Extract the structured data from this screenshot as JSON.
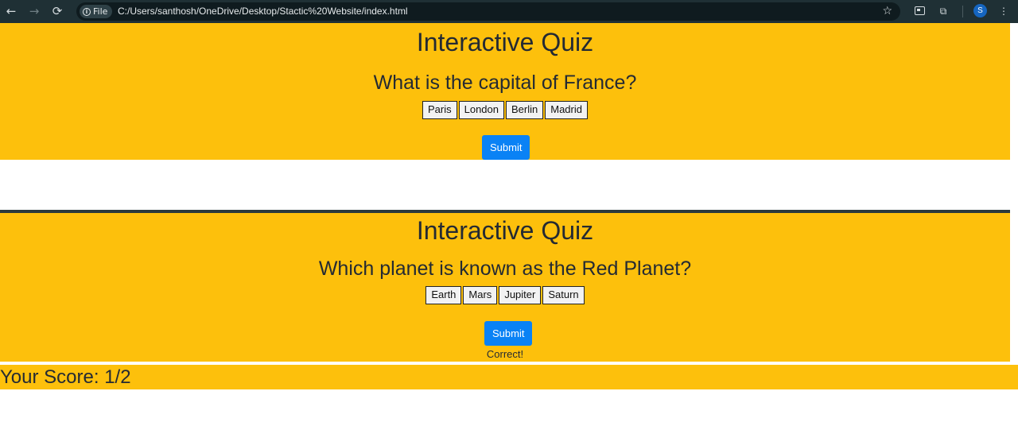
{
  "browser": {
    "back_icon": "←",
    "forward_icon": "→",
    "reload_icon": "⟳",
    "chip_icon": "i",
    "chip_label": "File",
    "url": "C:/Users/santhosh/OneDrive/Desktop/Stactic%20Website/index.html",
    "star_icon": "☆",
    "extensions_icon": "⧉",
    "profile_initial": "S",
    "menu_icon": "⋮"
  },
  "quizzes": [
    {
      "title": "Interactive Quiz",
      "question": "What is the capital of France?",
      "options": [
        "Paris",
        "London",
        "Berlin",
        "Madrid"
      ],
      "submit_label": "Submit",
      "feedback": ""
    },
    {
      "title": "Interactive Quiz",
      "question": "Which planet is known as the Red Planet?",
      "options": [
        "Earth",
        "Mars",
        "Jupiter",
        "Saturn"
      ],
      "submit_label": "Submit",
      "feedback": "Correct!"
    }
  ],
  "score": {
    "label": "Your Score: 1/2"
  },
  "colors": {
    "quiz_background": "#fdc00c",
    "submit_button": "#0a82f5",
    "text": "#242a33"
  }
}
